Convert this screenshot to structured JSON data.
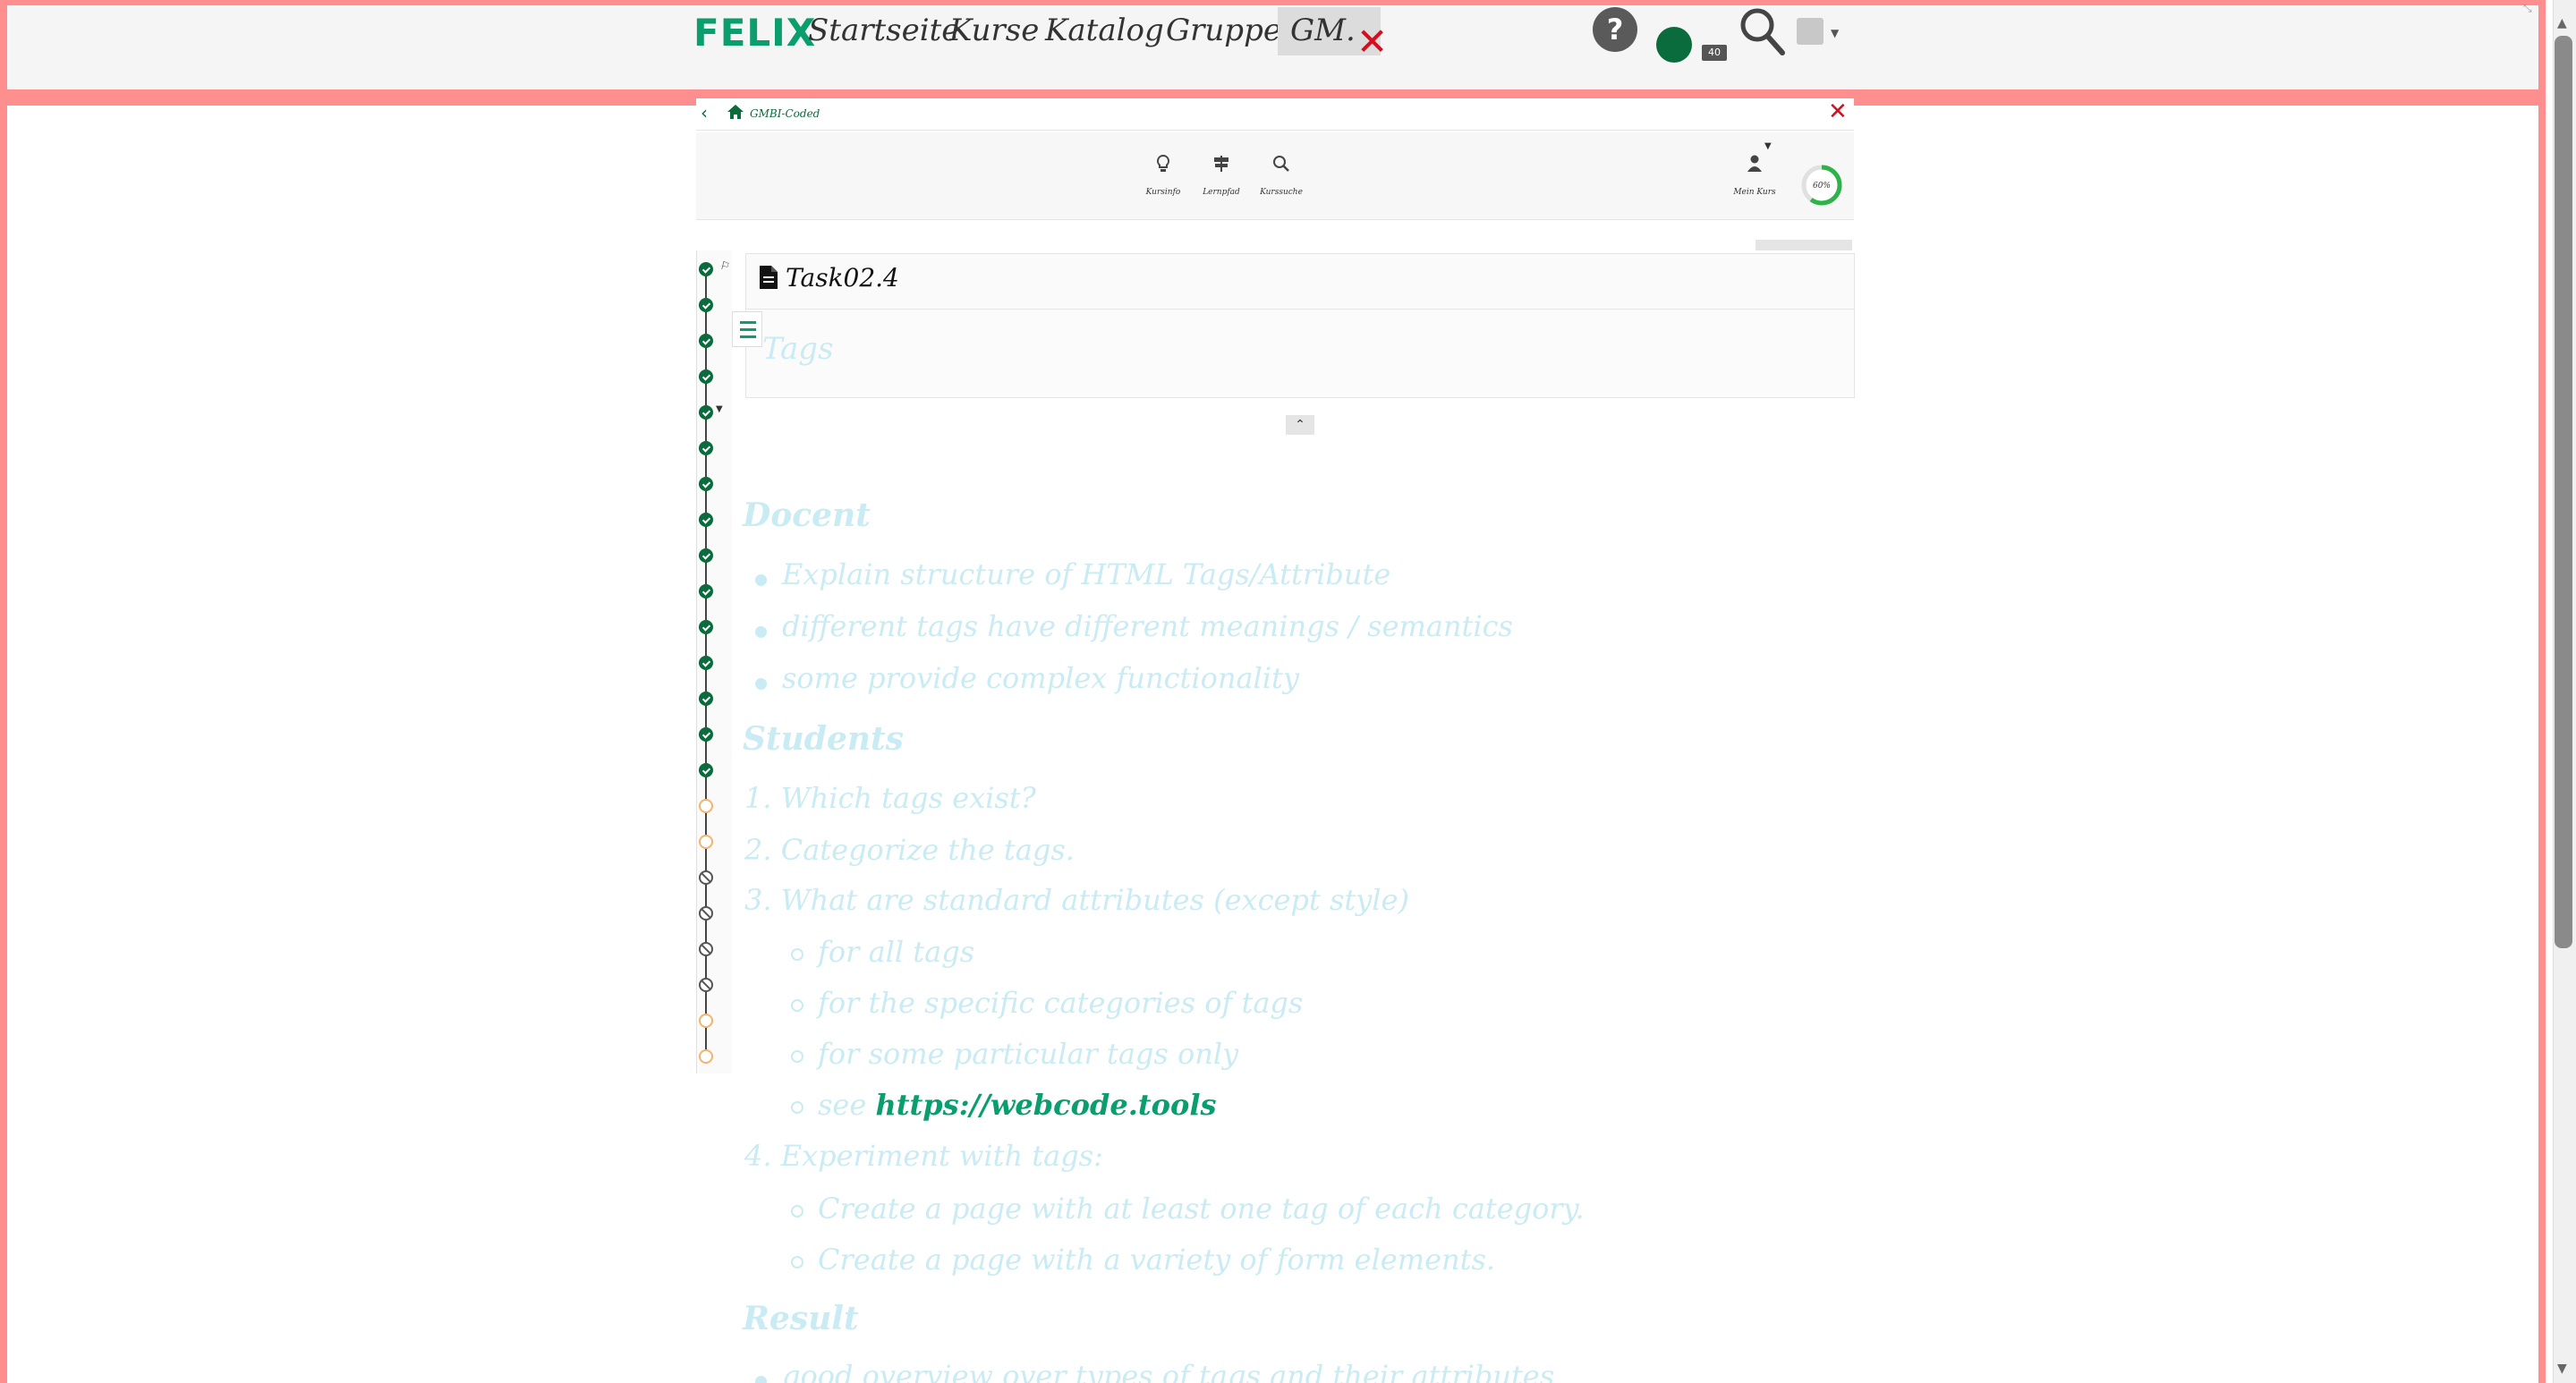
{
  "topnav": {
    "logo": "FELIX",
    "items": [
      "Startseite",
      "Kurse",
      "Katalog",
      "Gruppen"
    ],
    "active_tab": "GM.",
    "help_label": "?",
    "badge": "40"
  },
  "course": {
    "breadcrumb": "GMBI-Coded",
    "tools": [
      {
        "icon": "lightbulb-icon",
        "label": "Kursinfo"
      },
      {
        "icon": "signpost-icon",
        "label": "Lernpfad"
      },
      {
        "icon": "search-icon",
        "label": "Kurssuche"
      },
      {
        "icon": "person-icon",
        "label": "Mein Kurs"
      }
    ],
    "progress_percent": 60,
    "progress_label": "60%"
  },
  "timeline": {
    "nodes": [
      "done",
      "done",
      "done",
      "done",
      "done",
      "done",
      "done",
      "done",
      "done",
      "done",
      "done",
      "done",
      "done",
      "done",
      "done",
      "partial",
      "partial",
      "blocked",
      "blocked",
      "blocked",
      "blocked",
      "partial",
      "partial"
    ]
  },
  "task": {
    "title": "Task02.4",
    "tags_label": "Tags"
  },
  "content": {
    "docent_heading": "Docent",
    "docent_items": [
      "Explain structure of HTML Tags/Attribute",
      "different tags have different meanings / semantics",
      "some provide complex functionality"
    ],
    "students_heading": "Students",
    "students_items": [
      "1. Which tags exist?",
      "2. Categorize the tags.",
      "3. What are standard attributes (except style)"
    ],
    "attr_subitems": [
      "for all tags",
      "for the specific categories of tags",
      "for some particular tags only"
    ],
    "see_prefix": "see",
    "see_link": "https://webcode.tools",
    "experiment_item": "4. Experiment with tags:",
    "experiment_subitems": [
      "Create a page with at least one tag of each category.",
      "Create a page with a variety of form elements."
    ],
    "result_heading": "Result",
    "result_items": [
      "good overview over types of tags and their attributes"
    ]
  },
  "colors": {
    "brand_green": "#0a9e6e",
    "dark_green": "#0a6b3c",
    "accent_pink": "#ff8f8f",
    "faded_text": "#c9ebf3",
    "close_red": "#d01020"
  }
}
